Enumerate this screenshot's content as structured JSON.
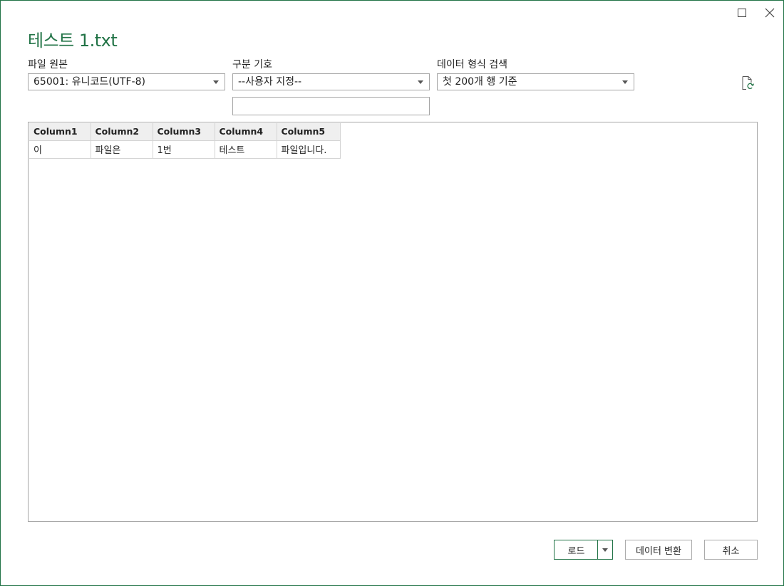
{
  "window": {
    "title": "테스트 1.txt",
    "accent_color": "#217346"
  },
  "controls": {
    "file_origin": {
      "label": "파일 원본",
      "value": "65001: 유니코드(UTF-8)"
    },
    "delimiter": {
      "label": "구분 기호",
      "value": "--사용자 지정--",
      "custom_value": ""
    },
    "data_type_detection": {
      "label": "데이터 형식 검색",
      "value": "첫 200개 행 기준"
    },
    "refresh_icon": "refresh-file-icon"
  },
  "preview": {
    "columns": [
      "Column1",
      "Column2",
      "Column3",
      "Column4",
      "Column5"
    ],
    "rows": [
      [
        "이",
        "파일은",
        "1번",
        "테스트",
        "파일입니다."
      ]
    ]
  },
  "buttons": {
    "load": "로드",
    "transform": "데이터 변환",
    "cancel": "취소"
  }
}
